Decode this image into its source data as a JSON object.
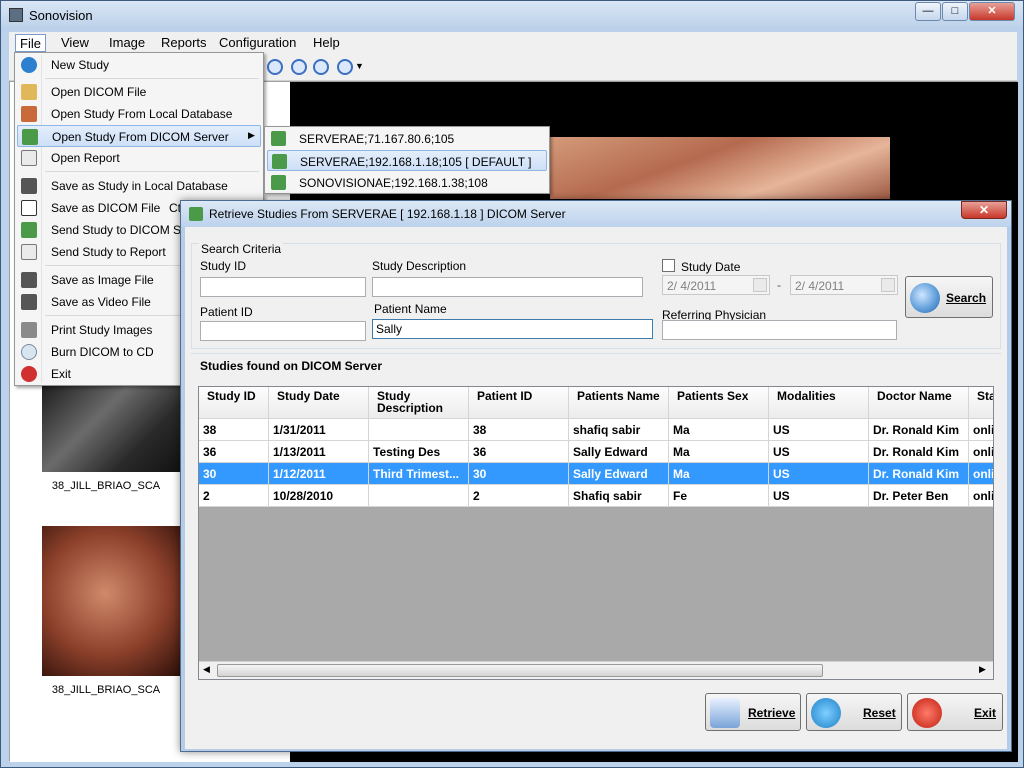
{
  "app": {
    "title": "Sonovision"
  },
  "menubar": {
    "file": "File",
    "view": "View",
    "image": "Image",
    "reports": "Reports",
    "configuration": "Configuration",
    "help": "Help"
  },
  "file_menu": {
    "new_study": "New Study",
    "open_dicom_file": "Open DICOM File",
    "open_study_local_db": "Open Study From Local Database",
    "open_study_dicom_server": "Open Study From DICOM Server",
    "open_report": "Open Report",
    "save_study_local_db": "Save as Study in Local Database",
    "save_dicom_file": "Save as DICOM File",
    "save_dicom_shortcut": "Ct",
    "send_study_dicom": "Send Study to DICOM Se",
    "send_study_report": "Send Study to Report",
    "save_image_file": "Save as Image File",
    "save_video_file": "Save as Video File",
    "print_study_images": "Print Study Images",
    "burn_dicom_cd": "Burn DICOM to CD",
    "exit": "Exit"
  },
  "submenu": {
    "items": [
      "SERVERAE;71.167.80.6;105",
      "SERVERAE;192.168.1.18;105  [ DEFAULT ]",
      "SONOVISIONAE;192.168.1.38;108"
    ]
  },
  "thumbnails": {
    "caption1": "38_JILL_BRIAO_SCA",
    "caption2": "38_JILL_BRIAO_SCA"
  },
  "dialog": {
    "title": "Retrieve Studies From  SERVERAE [ 192.168.1.18 ] DICOM Server",
    "search_criteria": "Search Criteria",
    "study_id_label": "Study ID",
    "study_id_value": "",
    "study_desc_label": "Study Description",
    "study_desc_value": "",
    "study_date_label": "Study Date",
    "date_from": "2/ 4/2011",
    "date_to": "2/ 4/2011",
    "date_sep": "-",
    "patient_id_label": "Patient ID",
    "patient_id_value": "",
    "patient_name_label": "Patient Name",
    "patient_name_value": "Sally",
    "referring_label": "Referring Physician",
    "referring_value": "",
    "search_button": "Search",
    "results_label": "Studies found on DICOM Server",
    "retrieve_button": "Retrieve",
    "reset_button": "Reset",
    "exit_button": "Exit"
  },
  "grid": {
    "columns": [
      "Study ID",
      "Study Date",
      "Study Description",
      "Patient ID",
      "Patients Name",
      "Patients Sex",
      "Modalities",
      "Doctor Name",
      "Sta"
    ],
    "rows": [
      [
        "38",
        "1/31/2011",
        "",
        "38",
        "shafiq sabir",
        "Ma",
        "US",
        "Dr. Ronald Kim",
        "onli"
      ],
      [
        "36",
        "1/13/2011",
        "Testing Des",
        "36",
        "Sally Edward",
        "Ma",
        "US",
        "Dr. Ronald Kim",
        "onli"
      ],
      [
        "30",
        "1/12/2011",
        "Third Trimest...",
        "30",
        "Sally Edward",
        "Ma",
        "US",
        "Dr. Ronald Kim",
        "onli"
      ],
      [
        "2",
        "10/28/2010",
        "",
        "2",
        "Shafiq sabir",
        "Fe",
        "US",
        "Dr. Peter Ben",
        "onli"
      ]
    ],
    "selected_row": 2
  },
  "colors": {
    "selection": "#3399ff",
    "menu_highlight": "#cde0f7"
  }
}
